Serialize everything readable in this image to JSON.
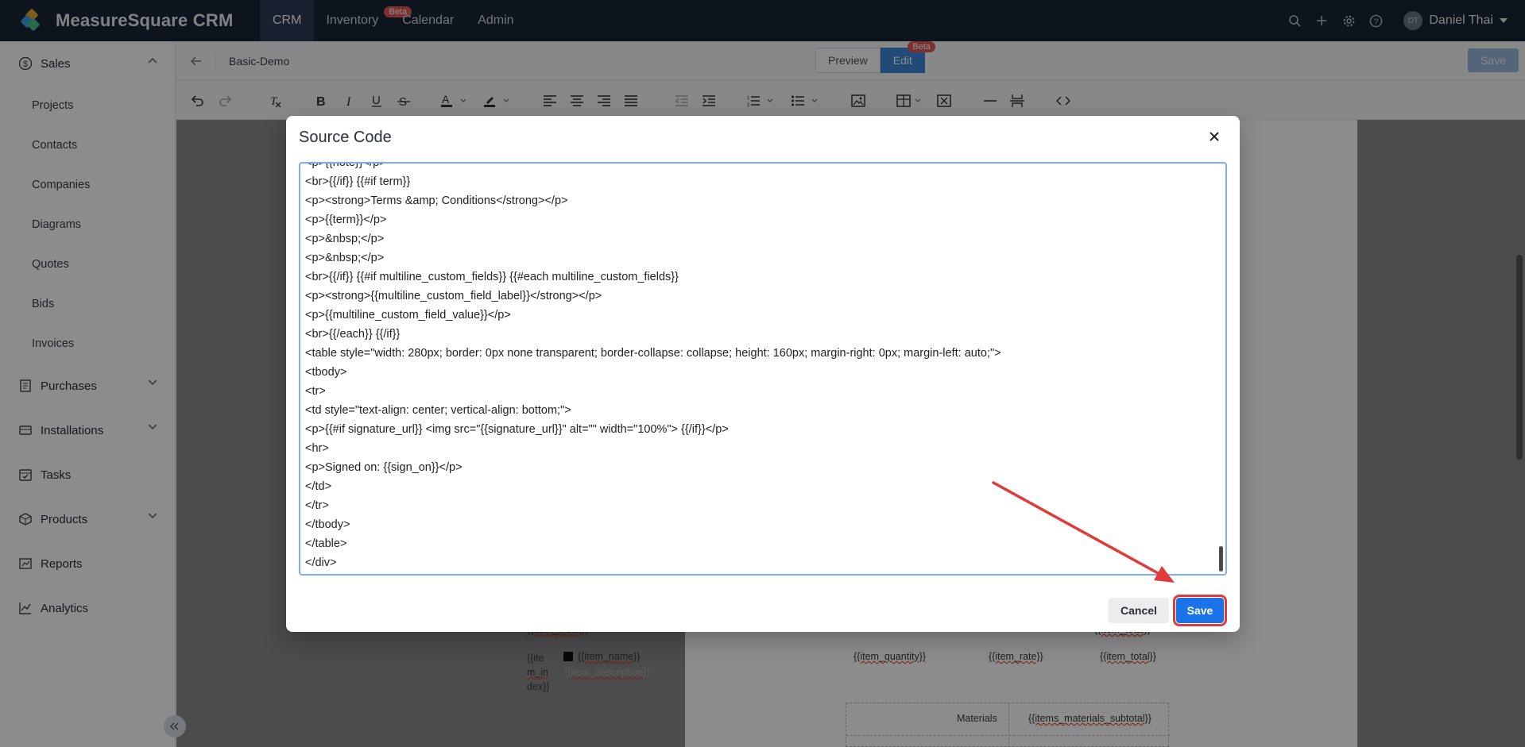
{
  "app": {
    "brand": "MeasureSquare CRM",
    "nav": [
      {
        "label": "CRM",
        "active": true
      },
      {
        "label": "Inventory",
        "badge": "Beta"
      },
      {
        "label": "Calendar"
      },
      {
        "label": "Admin"
      }
    ],
    "user": {
      "initials": "DT",
      "name": "Daniel Thai"
    },
    "nav_icons": [
      "search-icon",
      "plus-icon",
      "gear-icon",
      "help-icon"
    ]
  },
  "sidebar": {
    "sales": "Sales",
    "sales_items": [
      "Projects",
      "Contacts",
      "Companies",
      "Diagrams",
      "Quotes",
      "Bids",
      "Invoices"
    ],
    "purchases": "Purchases",
    "installations": "Installations",
    "tasks": "Tasks",
    "products": "Products",
    "reports": "Reports",
    "analytics": "Analytics"
  },
  "editor": {
    "doc_title": "Basic-Demo",
    "preview": "Preview",
    "edit": "Edit",
    "edit_badge": "Beta",
    "save": "Save"
  },
  "page_preview": {
    "placeholder_top": "{{item_index}}",
    "item_index": "{{ite",
    "item_index_2": "m_in",
    "item_index_3": "dex}}",
    "item_name": "{{item_name}}",
    "item_description": "{{item_description}}",
    "item_quantity": "{{item_quantity}}",
    "item_rate": "{{item_rate}}",
    "item_total": "{{item_total}}",
    "materials_label": "Materials",
    "materials_value": "{{items_materials_subtotal}}",
    "placeholder_top_right": "{{item_total}}"
  },
  "modal": {
    "title": "Source Code",
    "code_lines": [
      "<p>{{note}}</p>",
      "<br>{{/if}} {{#if term}}",
      "<p><strong>Terms &amp; Conditions</strong></p>",
      "<p>{{term}}</p>",
      "<p>&nbsp;</p>",
      "<p>&nbsp;</p>",
      "<br>{{/if}} {{#if multiline_custom_fields}} {{#each multiline_custom_fields}}",
      "<p><strong>{{multiline_custom_field_label}}</strong></p>",
      "<p>{{multiline_custom_field_value}}</p>",
      "<br>{{/each}} {{/if}}",
      "<table style=\"width: 280px; border: 0px none transparent; border-collapse: collapse; height: 160px; margin-right: 0px; margin-left: auto;\">",
      "<tbody>",
      "<tr>",
      "<td style=\"text-align: center; vertical-align: bottom;\">",
      "<p>{{#if signature_url}} <img src=\"{{signature_url}}\" alt=\"\" width=\"100%\"> {{/if}}</p>",
      "<hr>",
      "<p>Signed on: {{sign_on}}</p>",
      "</td>",
      "</tr>",
      "</tbody>",
      "</table>",
      "</div>"
    ],
    "cancel": "Cancel",
    "save": "Save"
  },
  "colors": {
    "nav_bg": "#1b2537",
    "primary": "#1a73e8",
    "highlight": "#e03a3a"
  }
}
